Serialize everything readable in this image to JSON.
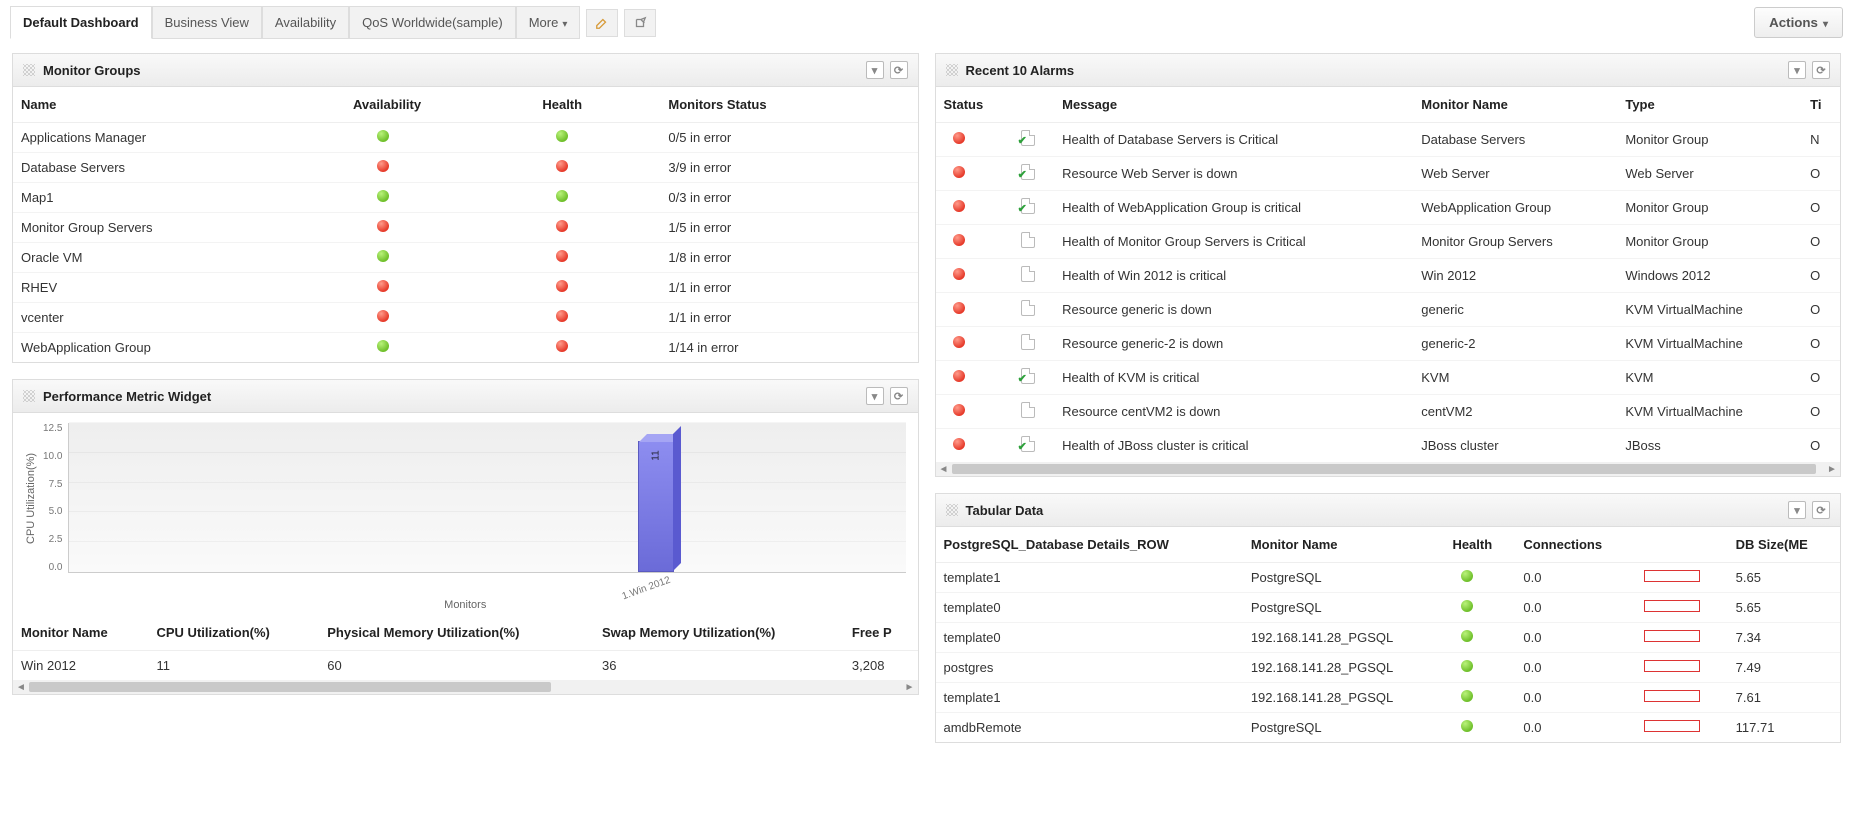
{
  "topbar": {
    "tabs": [
      {
        "label": "Default Dashboard",
        "active": true
      },
      {
        "label": "Business View"
      },
      {
        "label": "Availability"
      },
      {
        "label": "QoS Worldwide(sample)"
      },
      {
        "label": "More",
        "more": true
      }
    ],
    "actions_label": "Actions"
  },
  "monitor_groups": {
    "title": "Monitor Groups",
    "columns": [
      "Name",
      "Availability",
      "Health",
      "Monitors Status"
    ],
    "rows": [
      {
        "name": "Applications Manager",
        "avail": "green",
        "health": "green",
        "status": "0/5 in error"
      },
      {
        "name": "Database Servers",
        "avail": "red",
        "health": "red",
        "status": "3/9 in error"
      },
      {
        "name": "Map1",
        "avail": "green",
        "health": "green",
        "status": "0/3 in error"
      },
      {
        "name": "Monitor Group Servers",
        "avail": "red",
        "health": "red",
        "status": "1/5 in error"
      },
      {
        "name": "Oracle VM",
        "avail": "green",
        "health": "red",
        "status": "1/8 in error"
      },
      {
        "name": "RHEV",
        "avail": "red",
        "health": "red",
        "status": "1/1 in error"
      },
      {
        "name": "vcenter",
        "avail": "red",
        "health": "red",
        "status": "1/1 in error"
      },
      {
        "name": "WebApplication Group",
        "avail": "green",
        "health": "red",
        "status": "1/14 in error"
      }
    ]
  },
  "performance": {
    "title": "Performance Metric Widget",
    "columns": [
      "Monitor Name",
      "CPU Utilization(%)",
      "Physical Memory Utilization(%)",
      "Swap Memory Utilization(%)",
      "Free P"
    ],
    "rows": [
      {
        "name": "Win 2012",
        "cpu": "11",
        "mem": "60",
        "swap": "36",
        "free": "3,208"
      }
    ],
    "xaxis_label": "Monitors"
  },
  "chart_data": {
    "type": "bar",
    "title": "",
    "ylabel": "CPU Utilization(%)",
    "xlabel": "Monitors",
    "categories": [
      "1.Win 2012"
    ],
    "values": [
      11
    ],
    "ylim": [
      0,
      12.5
    ],
    "yticks": [
      0.0,
      2.5,
      5.0,
      7.5,
      10.0,
      12.5
    ]
  },
  "alarms": {
    "title": "Recent 10 Alarms",
    "columns": [
      "Status",
      "",
      "Message",
      "Monitor Name",
      "Type",
      "Ti"
    ],
    "rows": [
      {
        "status": "red",
        "icon": "check",
        "msg": "Health of Database Servers is Critical",
        "mon": "Database Servers",
        "type": "Monitor Group",
        "t": "N"
      },
      {
        "status": "red",
        "icon": "check",
        "msg": "Resource Web Server is down",
        "mon": "Web Server",
        "type": "Web Server",
        "t": "O"
      },
      {
        "status": "red",
        "icon": "check",
        "msg": "Health of WebApplication Group is critical",
        "mon": "WebApplication Group",
        "type": "Monitor Group",
        "t": "O"
      },
      {
        "status": "red",
        "icon": "doc",
        "msg": "Health of Monitor Group Servers is Critical",
        "mon": "Monitor Group Servers",
        "type": "Monitor Group",
        "t": "O"
      },
      {
        "status": "red",
        "icon": "doc",
        "msg": "Health of Win 2012 is critical",
        "mon": "Win 2012",
        "type": "Windows 2012",
        "t": "O"
      },
      {
        "status": "red",
        "icon": "doc",
        "msg": "Resource generic is down",
        "mon": "generic",
        "type": "KVM VirtualMachine",
        "t": "O"
      },
      {
        "status": "red",
        "icon": "doc",
        "msg": "Resource generic-2 is down",
        "mon": "generic-2",
        "type": "KVM VirtualMachine",
        "t": "O"
      },
      {
        "status": "red",
        "icon": "check",
        "msg": "Health of KVM is critical",
        "mon": "KVM",
        "type": "KVM",
        "t": "O"
      },
      {
        "status": "red",
        "icon": "doc",
        "msg": "Resource centVM2 is down",
        "mon": "centVM2",
        "type": "KVM VirtualMachine",
        "t": "O"
      },
      {
        "status": "red",
        "icon": "check",
        "msg": "Health of JBoss cluster is critical",
        "mon": "JBoss cluster",
        "type": "JBoss",
        "t": "O"
      }
    ]
  },
  "tabular": {
    "title": "Tabular Data",
    "columns": [
      "PostgreSQL_Database Details_ROW",
      "Monitor Name",
      "Health",
      "Connections",
      "",
      "DB Size(ME"
    ],
    "rows": [
      {
        "db": "template1",
        "mon": "PostgreSQL",
        "health": "green",
        "conn": "0.0",
        "size": "5.65"
      },
      {
        "db": "template0",
        "mon": "PostgreSQL",
        "health": "green",
        "conn": "0.0",
        "size": "5.65"
      },
      {
        "db": "template0",
        "mon": "192.168.141.28_PGSQL",
        "health": "green",
        "conn": "0.0",
        "size": "7.34"
      },
      {
        "db": "postgres",
        "mon": "192.168.141.28_PGSQL",
        "health": "green",
        "conn": "0.0",
        "size": "7.49"
      },
      {
        "db": "template1",
        "mon": "192.168.141.28_PGSQL",
        "health": "green",
        "conn": "0.0",
        "size": "7.61"
      },
      {
        "db": "amdbRemote",
        "mon": "PostgreSQL",
        "health": "green",
        "conn": "0.0",
        "size": "117.71"
      }
    ]
  }
}
